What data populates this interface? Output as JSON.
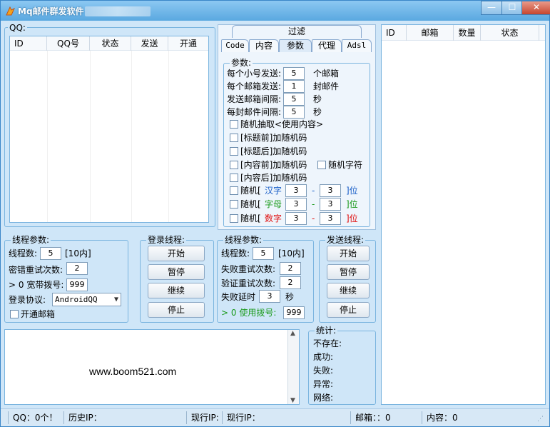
{
  "window": {
    "title": "Mq邮件群发软件",
    "controls": {
      "minimize": "—",
      "maximize": "☐",
      "close": "✕"
    }
  },
  "qq_group": {
    "title": "QQ:",
    "columns": [
      "ID",
      "QQ号",
      "状态",
      "发送",
      "开通"
    ]
  },
  "tabs": {
    "top_label": "过滤",
    "items": [
      "Code",
      "内容",
      "参数",
      "代理",
      "Adsl"
    ],
    "active": "参数"
  },
  "params": {
    "title": "参数:",
    "rows": [
      {
        "label": "每个小号发送:",
        "value": "5",
        "unit": "个邮箱"
      },
      {
        "label": "每个邮箱发送:",
        "value": "1",
        "unit": "封邮件"
      },
      {
        "label": "发送邮箱间隔:",
        "value": "5",
        "unit": "秒"
      },
      {
        "label": "每封邮件间隔:",
        "value": "5",
        "unit": "秒"
      }
    ],
    "checks": {
      "random_extract": "随机抽取<使用内容>",
      "title_before": "[标题前]加随机码",
      "title_after": "[标题后]加随机码",
      "content_before": "[内容前]加随机码",
      "random_char": "随机字符",
      "content_after": "[内容后]加随机码"
    },
    "random_rows": [
      {
        "prefix": "随机[",
        "kind": "汉字",
        "from": "3",
        "dash": "-",
        "to": "3",
        "suffix": "]位",
        "color": "#1a5fc8"
      },
      {
        "prefix": "随机[",
        "kind": "字母",
        "from": "3",
        "dash": "-",
        "to": "3",
        "suffix": "]位",
        "color": "#1a9a1a"
      },
      {
        "prefix": "随机[",
        "kind": "数字",
        "from": "3",
        "dash": "-",
        "to": "3",
        "suffix": "]位",
        "color": "#e01010"
      }
    ]
  },
  "login_thread": {
    "title": "线程参数:",
    "threads_label": "线程数:",
    "threads_value": "5",
    "threads_hint": "[10内]",
    "retry_label": "密错重试次数:",
    "retry_value": "2",
    "dial_label": "> 0 宽带拨号:",
    "dial_value": "999",
    "protocol_label": "登录协议:",
    "protocol_value": "AndroidQQ",
    "open_mail_label": "开通邮箱"
  },
  "login_buttons": {
    "title": "登录线程:",
    "start": "开始",
    "pause": "暂停",
    "resume": "继续",
    "stop": "停止"
  },
  "send_thread": {
    "title": "线程参数:",
    "threads_label": "线程数:",
    "threads_value": "5",
    "threads_hint": "[10内]",
    "fail_retry_label": "失败重试次数:",
    "fail_retry_value": "2",
    "verify_retry_label": "验证重试次数:",
    "verify_retry_value": "2",
    "fail_delay_label": "失败延时",
    "fail_delay_value": "3",
    "fail_delay_unit": "秒",
    "dial_label": "> 0 使用拨号:",
    "dial_value": "999"
  },
  "send_buttons": {
    "title": "发送线程:",
    "start": "开始",
    "pause": "暂停",
    "resume": "继续",
    "stop": "停止"
  },
  "log": {
    "text": "www.boom521.com"
  },
  "stats": {
    "title": "统计:",
    "items": [
      "不存在:",
      "成功:",
      "失败:",
      "异常:",
      "网络:"
    ]
  },
  "mail_list": {
    "columns": [
      "ID",
      "邮箱",
      "数量",
      "状态"
    ]
  },
  "statusbar": {
    "qq": "QQ：0个！",
    "history_ip": "历史IP：",
    "current_ip_a": "现行IP:",
    "current_ip_b": "现行IP：",
    "mailbox": "邮箱：：0",
    "content": "内容：0"
  }
}
